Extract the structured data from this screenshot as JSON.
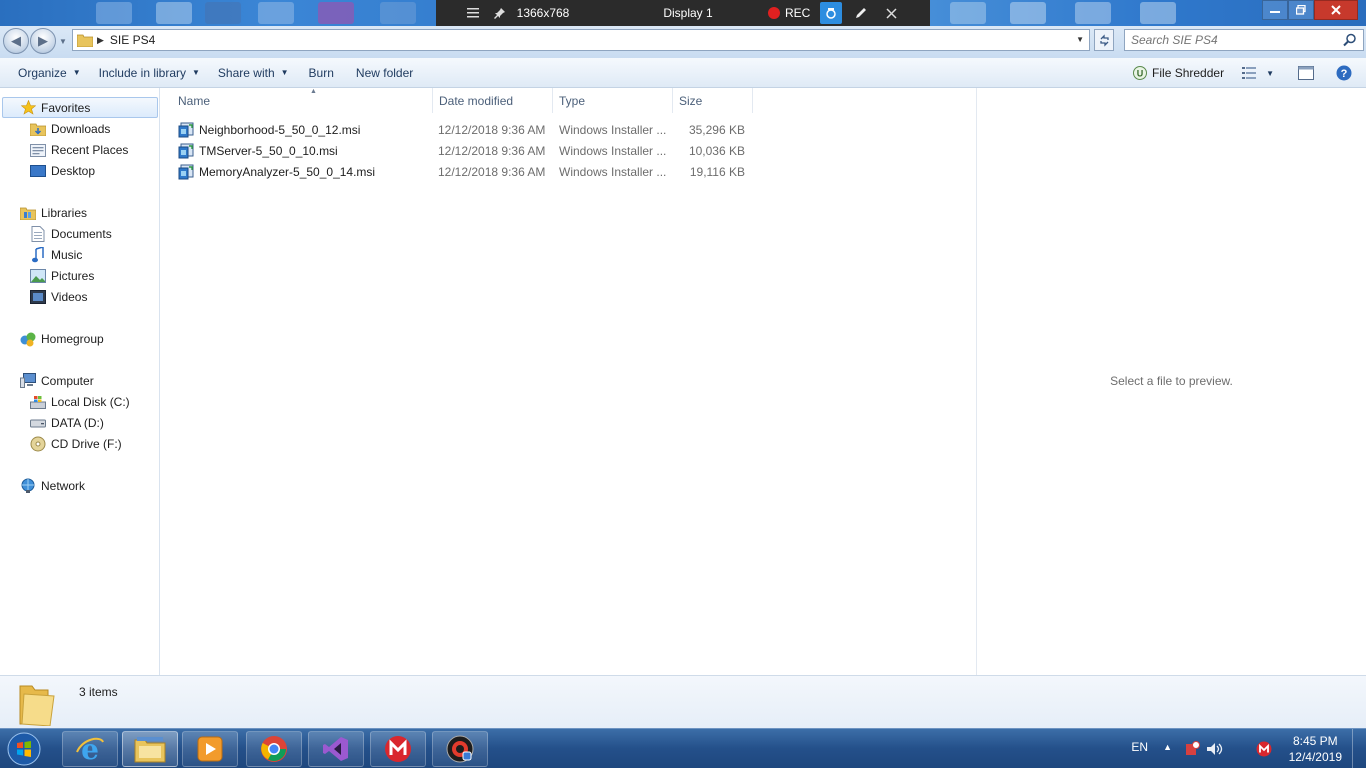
{
  "recorder": {
    "resolution": "1366x768",
    "display": "Display 1",
    "rec_label": "REC"
  },
  "address": {
    "path": "SIE PS4",
    "search_placeholder": "Search SIE PS4"
  },
  "toolbar": {
    "organize": "Organize",
    "include_in_library": "Include in library",
    "share_with": "Share with",
    "burn": "Burn",
    "new_folder": "New folder",
    "file_shredder": "File Shredder"
  },
  "nav": {
    "favorites": "Favorites",
    "downloads": "Downloads",
    "recent_places": "Recent Places",
    "desktop": "Desktop",
    "libraries": "Libraries",
    "documents": "Documents",
    "music": "Music",
    "pictures": "Pictures",
    "videos": "Videos",
    "homegroup": "Homegroup",
    "computer": "Computer",
    "local_disk": "Local Disk (C:)",
    "data_drive": "DATA (D:)",
    "cd_drive": "CD Drive (F:)",
    "network": "Network"
  },
  "columns": {
    "name": "Name",
    "date_modified": "Date modified",
    "type": "Type",
    "size": "Size"
  },
  "files": [
    {
      "name": "Neighborhood-5_50_0_12.msi",
      "date": "12/12/2018 9:36 AM",
      "type": "Windows Installer ...",
      "size": "35,296 KB"
    },
    {
      "name": "TMServer-5_50_0_10.msi",
      "date": "12/12/2018 9:36 AM",
      "type": "Windows Installer ...",
      "size": "10,036 KB"
    },
    {
      "name": "MemoryAnalyzer-5_50_0_14.msi",
      "date": "12/12/2018 9:36 AM",
      "type": "Windows Installer ...",
      "size": "19,116 KB"
    }
  ],
  "preview": {
    "message": "Select a file to preview."
  },
  "details": {
    "count": "3 items"
  },
  "taskbar": {
    "language": "EN",
    "time": "8:45 PM",
    "date": "12/4/2019"
  },
  "colors": {
    "taskbar": "#24508a",
    "titlebar": "#2f77c9",
    "rec_red": "#e02020"
  }
}
